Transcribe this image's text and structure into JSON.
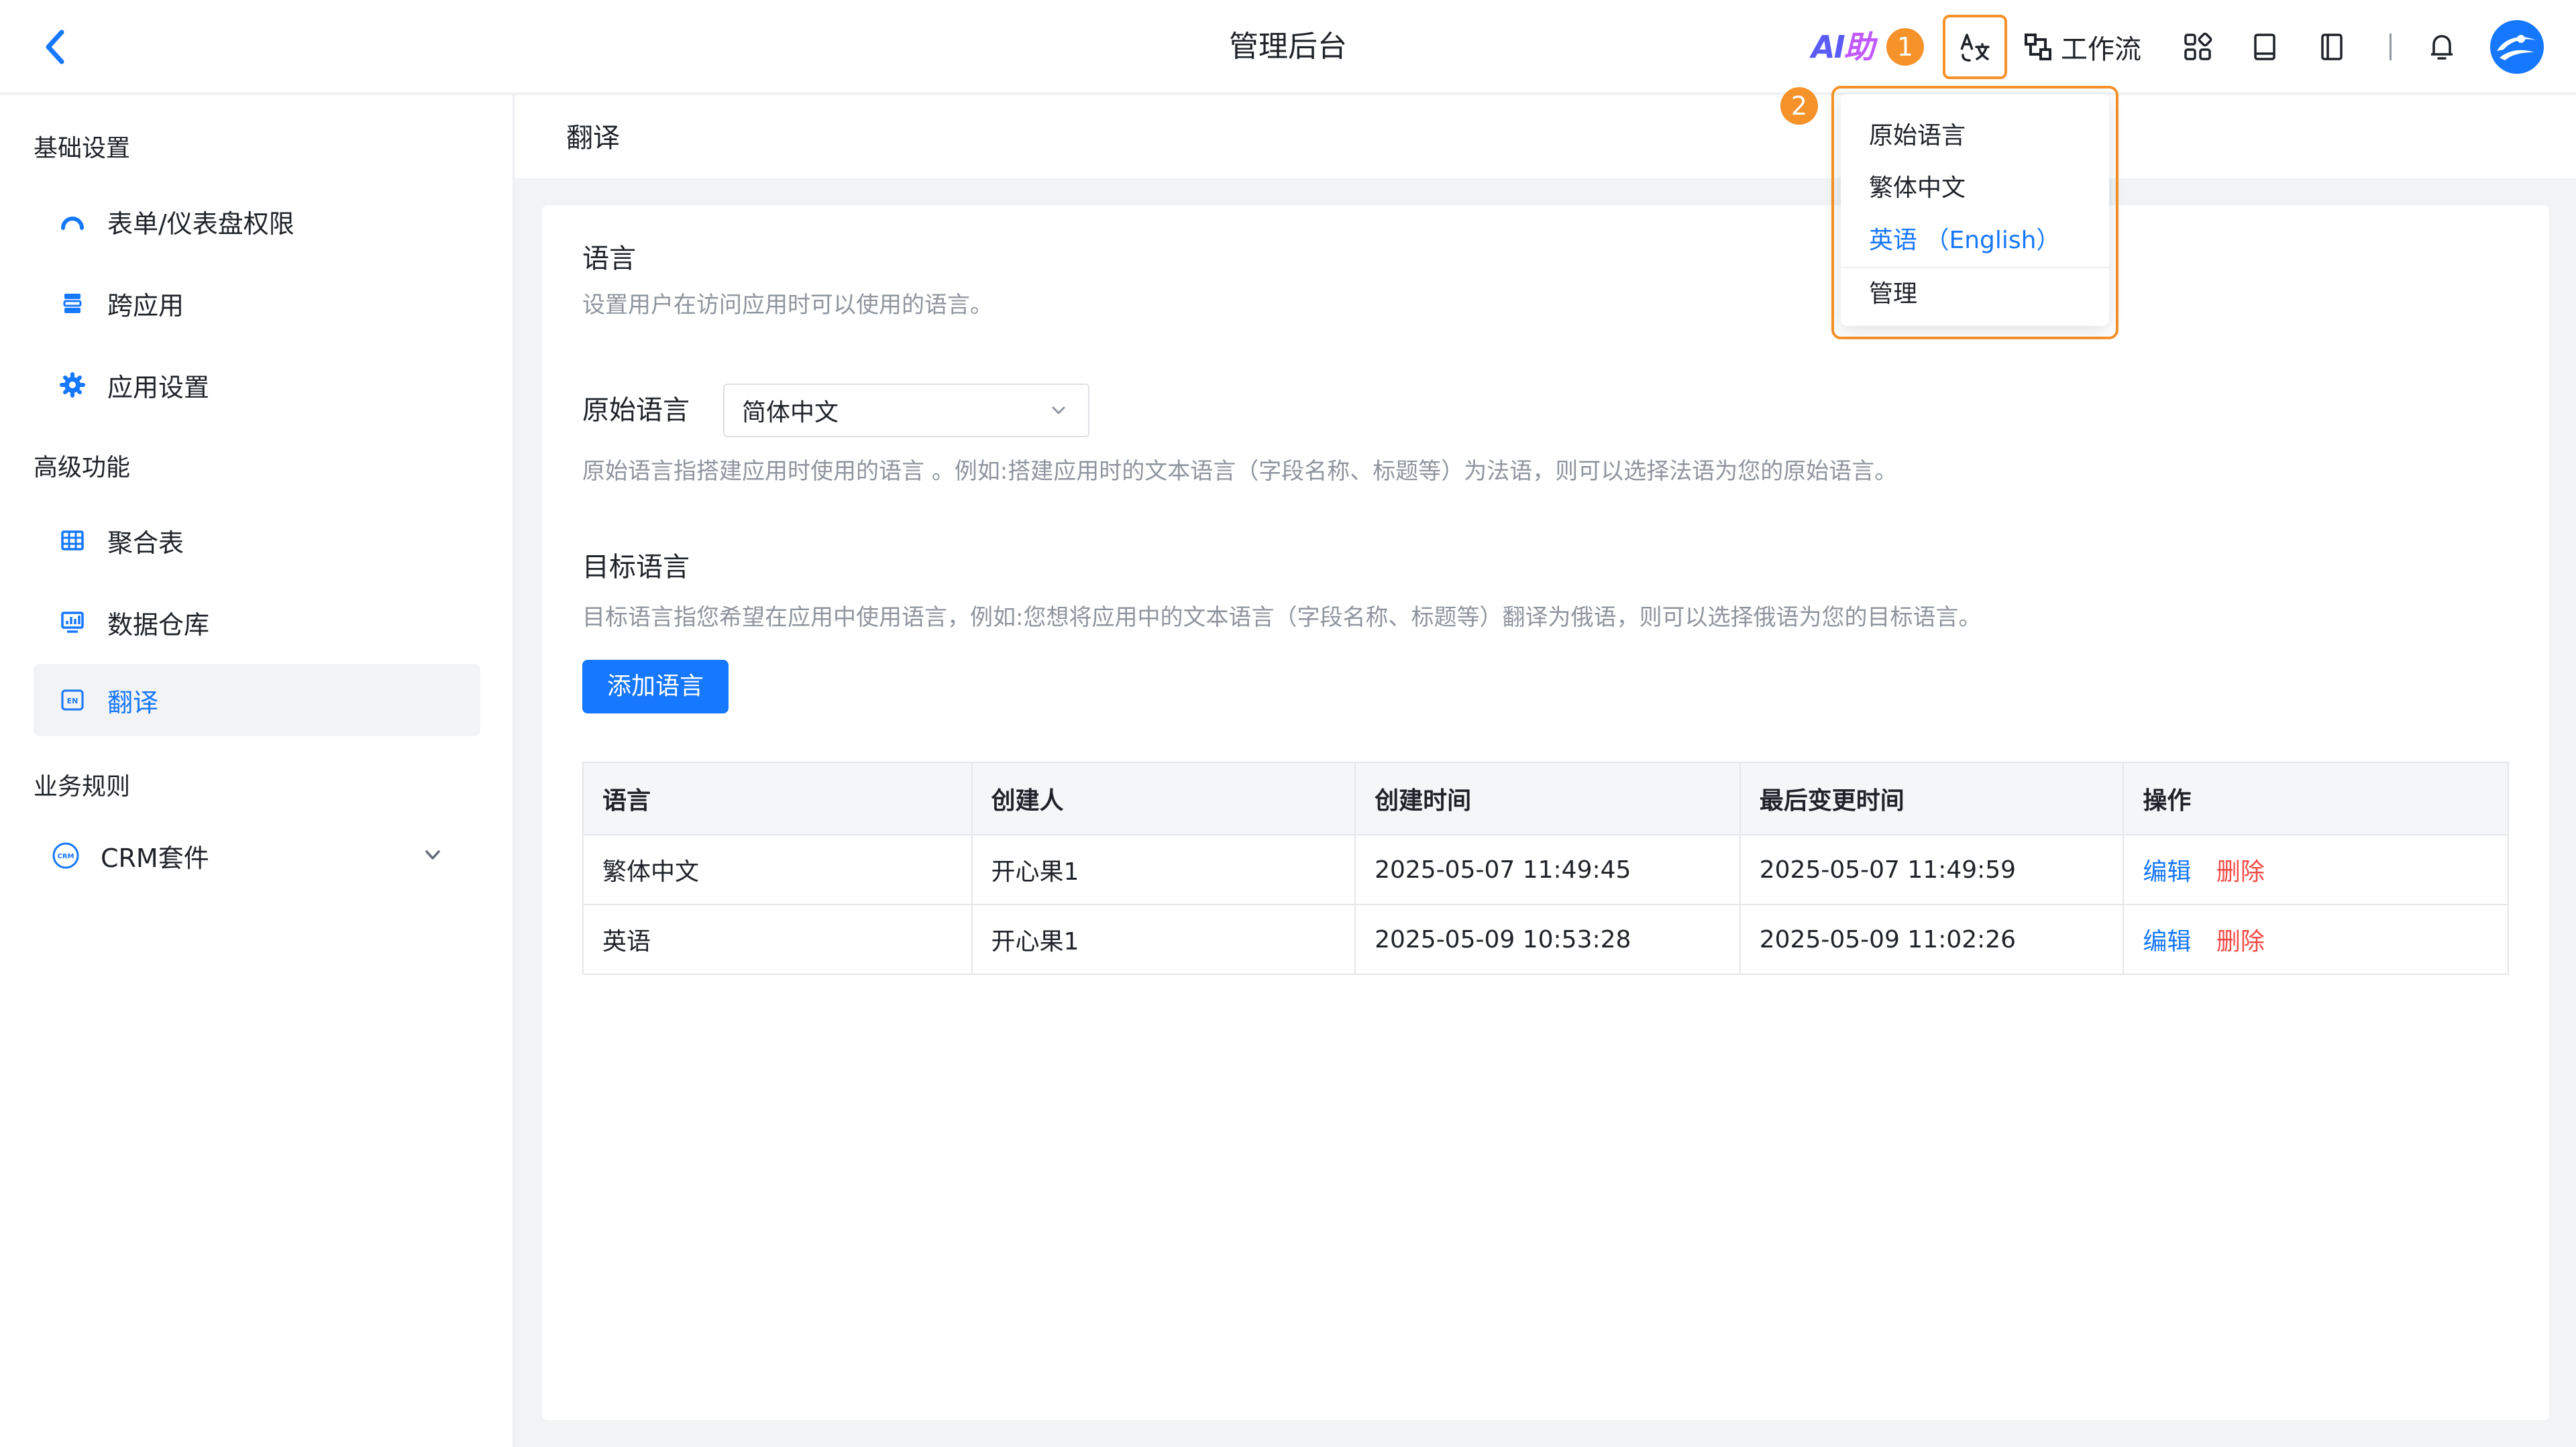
{
  "header": {
    "title": "管理后台",
    "ai_logo_ai": "AI",
    "ai_logo_zh": "助",
    "workflow_label": "工作流",
    "marker_1": "1",
    "marker_2": "2"
  },
  "language_menu": {
    "items": [
      {
        "label": "原始语言",
        "active": false
      },
      {
        "label": "繁体中文",
        "active": false
      },
      {
        "label": "英语 （English）",
        "active": true
      }
    ],
    "manage_label": "管理"
  },
  "sidebar": {
    "groups": [
      {
        "title": "基础设置",
        "items": [
          {
            "label": "表单/仪表盘权限",
            "icon": "gauge-icon"
          },
          {
            "label": "跨应用",
            "icon": "cross-app-icon"
          },
          {
            "label": "应用设置",
            "icon": "gear-icon"
          }
        ]
      },
      {
        "title": "高级功能",
        "items": [
          {
            "label": "聚合表",
            "icon": "table-icon"
          },
          {
            "label": "数据仓库",
            "icon": "data-warehouse-icon"
          },
          {
            "label": "翻译",
            "icon": "translate-en-icon",
            "selected": true
          }
        ]
      },
      {
        "title": "业务规则",
        "items": [
          {
            "label": "CRM套件",
            "icon": "crm-icon"
          }
        ]
      }
    ]
  },
  "page": {
    "subheader_title": "翻译",
    "language_section_title": "语言",
    "language_section_desc": "设置用户在访问应用时可以使用的语言。",
    "original_label": "原始语言",
    "original_value": "简体中文",
    "original_desc": "原始语言指搭建应用时使用的语言 。例如:搭建应用时的文本语言（字段名称、标题等）为法语，则可以选择法语为您的原始语言。",
    "target_title": "目标语言",
    "target_desc": "目标语言指您希望在应用中使用语言，例如:您想将应用中的文本语言（字段名称、标题等）翻译为俄语，则可以选择俄语为您的目标语言。",
    "add_button": "添加语言"
  },
  "table": {
    "columns": [
      "语言",
      "创建人",
      "创建时间",
      "最后变更时间",
      "操作"
    ],
    "rows": [
      {
        "language": "繁体中文",
        "creator": "开心果1",
        "created": "2025-05-07 11:49:45",
        "modified": "2025-05-07 11:49:59",
        "edit": "编辑",
        "delete": "删除"
      },
      {
        "language": "英语",
        "creator": "开心果1",
        "created": "2025-05-09 10:53:28",
        "modified": "2025-05-09 11:02:26",
        "edit": "编辑",
        "delete": "删除"
      }
    ]
  },
  "colors": {
    "accent": "#1677ff",
    "highlight": "#f5922a",
    "danger": "#f54a45"
  }
}
